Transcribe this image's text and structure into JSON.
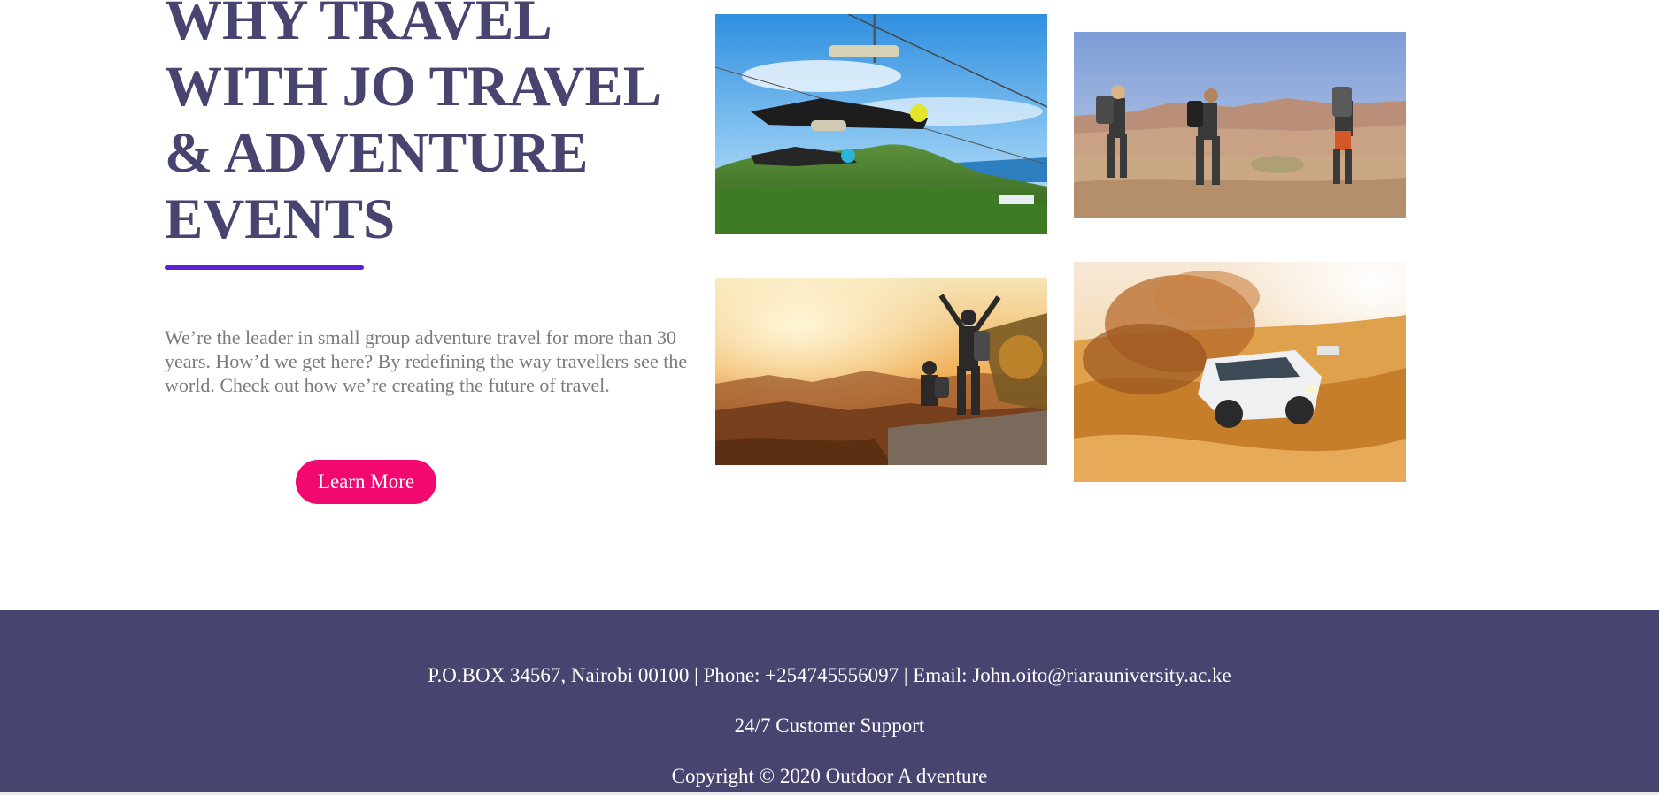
{
  "intro": {
    "title_lines": [
      "WHY TRAVEL",
      "WITH JO TRAVEL",
      "& ADVENTURE",
      "EVENTS"
    ],
    "description": "We’re the leader in small group adventure travel for more than 30 years. How’d we get here? By redefining the way travellers see the world. Check out how we’re creating the future of travel.",
    "button_label": "Learn More"
  },
  "colors": {
    "title": "#47456f",
    "accent_underline": "#5b1fd6",
    "button": "#f2096f",
    "footer_background": "#47456f",
    "body_text": "#7b7b7b"
  },
  "gallery": {
    "photos": [
      {
        "subject": "zipline-over-coast"
      },
      {
        "subject": "hikers-in-canyon"
      },
      {
        "subject": "hikers-on-summit-at-sunset"
      },
      {
        "subject": "4x4-driving-on-desert-dunes"
      }
    ]
  },
  "footer": {
    "contact": "P.O.BOX 34567, Nairobi 00100 | Phone: +254745556097 | Email: John.oito@riarauniversity.ac.ke",
    "support": "24/7 Customer Support",
    "copyright": "Copyright © 2020 Outdoor A dventure"
  }
}
